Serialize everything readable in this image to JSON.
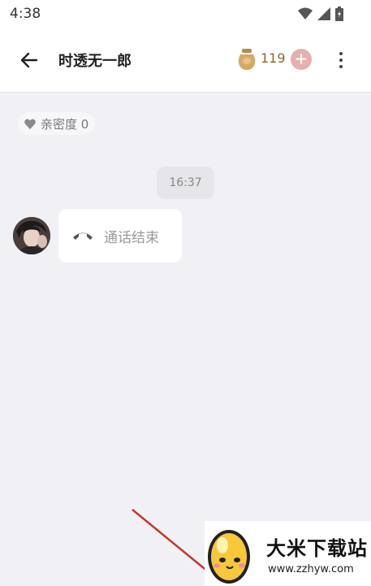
{
  "status_bar": {
    "time": "4:38",
    "icons": [
      "wifi-icon",
      "signal-icon",
      "battery-icon"
    ]
  },
  "header": {
    "title": "时透无一郎",
    "coins": "119",
    "add_label": "+",
    "icons": [
      "back-arrow-icon",
      "coin-pot-icon",
      "more-vertical-icon"
    ]
  },
  "chat": {
    "intimacy_label": "亲密度 0",
    "timestamp": "16:37",
    "messages": [
      {
        "type": "call",
        "text": "通话结束",
        "icon": "phone-hangup-icon"
      }
    ]
  },
  "watermark": {
    "title": "大米下载站",
    "url": "www.zzhyw.com"
  },
  "colors": {
    "background": "#f0f0f5",
    "coin_text": "#8a6a30",
    "add_button": "#e4b0b0",
    "arrow": "#c0392b"
  }
}
